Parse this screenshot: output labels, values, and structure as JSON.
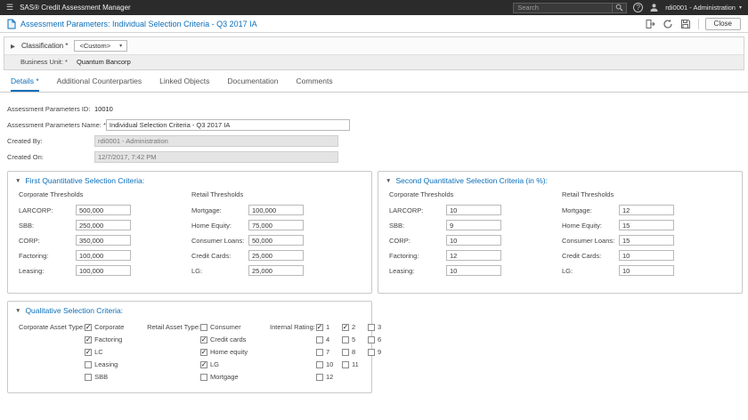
{
  "icons": {
    "hamburger": "☰",
    "expand": "▶",
    "collapse": "▼",
    "caret_down": "▾",
    "help": "?"
  },
  "topbar": {
    "app_title": "SAS® Credit Assessment Manager",
    "search_placeholder": "Search",
    "user_label": "rdi0001 - Administration"
  },
  "titlebar": {
    "title": "Assessment Parameters: Individual Selection Criteria - Q3 2017 IA",
    "close_label": "Close"
  },
  "classification": {
    "label": "Classification *",
    "value": "<Custom>",
    "business_unit_label": "Business Unit: *",
    "business_unit_value": "Quantum Bancorp"
  },
  "tabs": [
    {
      "label": "Details *",
      "active": true
    },
    {
      "label": "Additional Counterparties",
      "active": false
    },
    {
      "label": "Linked Objects",
      "active": false
    },
    {
      "label": "Documentation",
      "active": false
    },
    {
      "label": "Comments",
      "active": false
    }
  ],
  "form": {
    "id_label": "Assessment Parameters ID:",
    "id_value": "10010",
    "name_label": "Assessment Parameters Name: *",
    "name_value": "Individual Selection Criteria - Q3 2017 IA",
    "created_by_label": "Created By:",
    "created_by_value": "rdi0001 - Administration",
    "created_on_label": "Created On:",
    "created_on_value": "12/7/2017, 7:42 PM"
  },
  "first_criteria": {
    "title": "First Quantitative Selection Criteria:",
    "corporate_header": "Corporate Thresholds",
    "retail_header": "Retail Thresholds",
    "corporate": [
      {
        "label": "LARCORP:",
        "value": "500,000"
      },
      {
        "label": "SBB:",
        "value": "250,000"
      },
      {
        "label": "CORP:",
        "value": "350,000"
      },
      {
        "label": "Factoring:",
        "value": "100,000"
      },
      {
        "label": "Leasing:",
        "value": "100,000"
      }
    ],
    "retail": [
      {
        "label": "Mortgage:",
        "value": "100,000"
      },
      {
        "label": "Home Equity:",
        "value": "75,000"
      },
      {
        "label": "Consumer Loans:",
        "value": "50,000"
      },
      {
        "label": "Credit Cards:",
        "value": "25,000"
      },
      {
        "label": "LG:",
        "value": "25,000"
      }
    ]
  },
  "second_criteria": {
    "title": "Second Quantitative Selection Criteria (in %):",
    "corporate_header": "Corporate Thresholds",
    "retail_header": "Retail Thresholds",
    "corporate": [
      {
        "label": "LARCORP:",
        "value": "10"
      },
      {
        "label": "SBB:",
        "value": "9"
      },
      {
        "label": "CORP:",
        "value": "10"
      },
      {
        "label": "Factoring:",
        "value": "12"
      },
      {
        "label": "Leasing:",
        "value": "10"
      }
    ],
    "retail": [
      {
        "label": "Mortgage:",
        "value": "12"
      },
      {
        "label": "Home Equity:",
        "value": "15"
      },
      {
        "label": "Consumer Loans:",
        "value": "15"
      },
      {
        "label": "Credit Cards:",
        "value": "10"
      },
      {
        "label": "LG:",
        "value": "10"
      }
    ]
  },
  "qualitative": {
    "title": "Qualitative Selection Criteria:",
    "corporate_label": "Corporate Asset Type:",
    "corporate_items": [
      {
        "label": "Corporate",
        "checked": true
      },
      {
        "label": "Factoring",
        "checked": true
      },
      {
        "label": "LC",
        "checked": true
      },
      {
        "label": "Leasing",
        "checked": false
      },
      {
        "label": "SBB",
        "checked": false
      }
    ],
    "retail_label": "Retail Asset Type:",
    "retail_items": [
      {
        "label": "Consumer",
        "checked": false
      },
      {
        "label": "Credit cards",
        "checked": true
      },
      {
        "label": "Home equity",
        "checked": true
      },
      {
        "label": "LG",
        "checked": true
      },
      {
        "label": "Mortgage",
        "checked": false
      }
    ],
    "rating_label": "Internal Rating:",
    "rating_items": [
      {
        "label": "1",
        "checked": true
      },
      {
        "label": "2",
        "checked": true
      },
      {
        "label": "3",
        "checked": false
      },
      {
        "label": "4",
        "checked": false
      },
      {
        "label": "5",
        "checked": false
      },
      {
        "label": "6",
        "checked": false
      },
      {
        "label": "7",
        "checked": false
      },
      {
        "label": "8",
        "checked": false
      },
      {
        "label": "9",
        "checked": false
      },
      {
        "label": "10",
        "checked": false
      },
      {
        "label": "11",
        "checked": false
      },
      {
        "label": "12",
        "checked": false
      }
    ]
  },
  "colors": {
    "accent_blue": "#0b6fba",
    "topbar_bg": "#2b2b2b"
  }
}
